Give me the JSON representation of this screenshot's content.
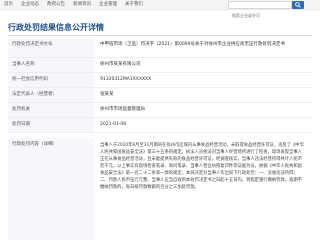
{
  "nav": {
    "items": [
      "首页",
      "企业动态",
      "政府公告",
      "新闻资讯",
      "企业管理",
      "关于我们"
    ]
  },
  "search": {
    "placeholder": "搜索企业或许可"
  },
  "page": {
    "title": "行政处罚结果信息公开详情"
  },
  "info": {
    "rows": [
      {
        "label": "行政处罚决定书文号",
        "value": "中甲宿市场（卫监）罚决字（2021）第0009号关于对徐州市企业供应商无证行政处罚决定书"
      },
      {
        "label": "当事人名称",
        "value": "徐州市某某有限公司"
      },
      {
        "label": "统一社会信用代码",
        "value": "91320312MA1XXXXXX"
      },
      {
        "label": "法定代表人（经营者）",
        "value": "张某某"
      },
      {
        "label": "处罚机关",
        "value": "徐州市市场监督管理局"
      },
      {
        "label": "处罚日期",
        "value": "2021-01-08"
      }
    ]
  },
  "content": {
    "label": "行政处罚内容（详细）",
    "text": "当事人于2020年9月至11月期间在徐州市区域内从事食品经营活动，未取得食品经营许可证，违反了《中华人民共和国食品安全法》第三十五条的规定。执法人员依法对当事人经营场所进行了检查，现场发现当事人正在从事食品经营活动，且未能提供有效的食品经营许可证。经调查核实，当事人违法经营所得共计人民币若干元。以上事实有现场检查笔录、询问笔录、当事人营业执照复印件等证据为证。依据《中华人民共和国食品安全法》第一百二十二条第一款的规定，本局决定对当事人作出如下行政处罚：一、没收违法所得；二、罚款人民币伍万元整。当事人应当自收到本处罚决定书之日起十五日内，到指定银行缴纳罚款。逾期不缴纳罚款的，每日按罚款数额的百分之三加处罚款。"
  },
  "colors": {
    "accent": "#2f6fb0",
    "title": "#1f4e8c",
    "label_bg": "#f5f7fa"
  }
}
